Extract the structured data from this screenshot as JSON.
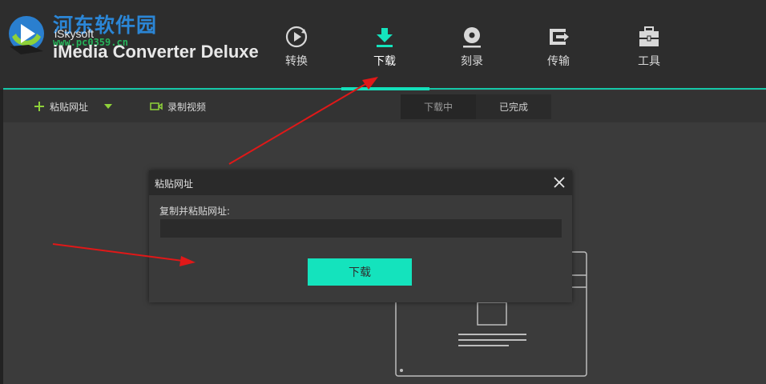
{
  "header": {
    "watermark_text": "河东软件园",
    "watermark_url": "www.pc0359.cn",
    "brand_small": "iSkysoft",
    "brand_name": "iMedia Converter Deluxe",
    "nav": [
      {
        "label": "转换",
        "icon": "convert-icon"
      },
      {
        "label": "下载",
        "icon": "download-icon",
        "active": true
      },
      {
        "label": "刻录",
        "icon": "burn-disc-icon"
      },
      {
        "label": "传输",
        "icon": "transfer-icon"
      },
      {
        "label": "工具",
        "icon": "toolbox-icon"
      }
    ]
  },
  "toolbar": {
    "paste_url_label": "粘贴网址",
    "record_video_label": "录制视频",
    "tabs": [
      {
        "label": "下载中",
        "active": true
      },
      {
        "label": "已完成",
        "active": false
      }
    ]
  },
  "dialog": {
    "title": "粘贴网址",
    "field_label": "复制并粘贴网址:",
    "field_value": "",
    "download_button": "下载"
  },
  "colors": {
    "accent": "#14e3bd",
    "header_bg": "#2d2d2d",
    "body_bg": "#3b3b3b",
    "annotation_arrow": "#e01818"
  }
}
